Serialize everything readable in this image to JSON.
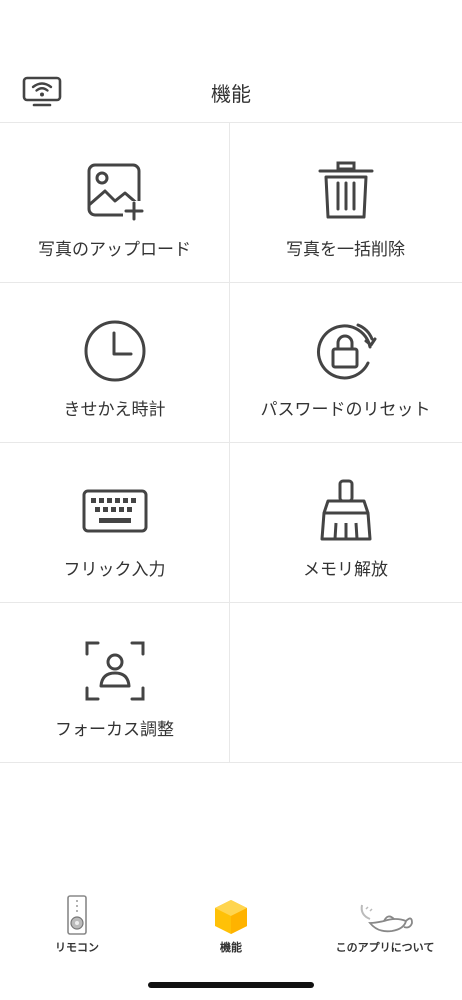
{
  "header": {
    "title": "機能",
    "cast_icon": "wifi-display-icon"
  },
  "features": [
    {
      "label": "写真のアップロード",
      "icon": "photo-upload-icon"
    },
    {
      "label": "写真を一括削除",
      "icon": "trash-icon"
    },
    {
      "label": "きせかえ時計",
      "icon": "clock-icon"
    },
    {
      "label": "パスワードのリセット",
      "icon": "lock-reset-icon"
    },
    {
      "label": "フリック入力",
      "icon": "keyboard-icon"
    },
    {
      "label": "メモリ解放",
      "icon": "broom-icon"
    },
    {
      "label": "フォーカス調整",
      "icon": "focus-person-icon"
    }
  ],
  "tabbar": {
    "items": [
      {
        "label": "リモコン",
        "icon": "remote-icon"
      },
      {
        "label": "機能",
        "icon": "cube-icon",
        "active": true
      },
      {
        "label": "このアプリについて",
        "icon": "genie-lamp-icon"
      }
    ],
    "accent_color": "#FFC107"
  }
}
